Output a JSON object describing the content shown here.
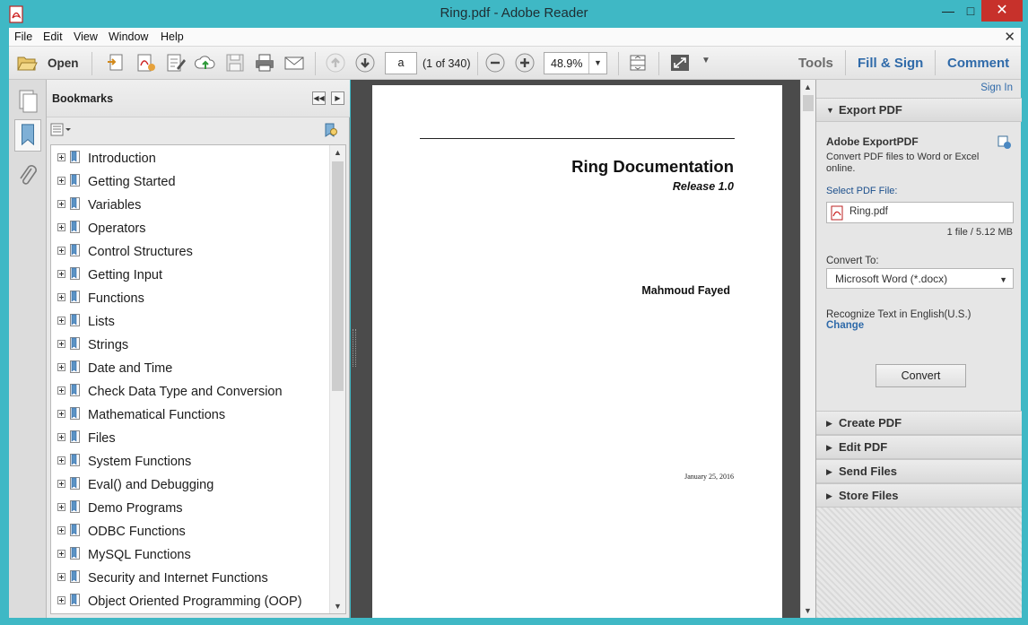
{
  "window": {
    "title": "Ring.pdf - Adobe Reader",
    "minimize": "—",
    "maximize": "□",
    "close": "✕"
  },
  "menu": {
    "items": [
      "File",
      "Edit",
      "View",
      "Window",
      "Help"
    ],
    "close_glyph": "✕"
  },
  "toolbar": {
    "open_label": "Open",
    "page_value": "a",
    "page_count": "(1 of 340)",
    "zoom": "48.9%",
    "tools": "Tools",
    "fill_sign": "Fill & Sign",
    "comment": "Comment"
  },
  "bookmarks": {
    "title": "Bookmarks",
    "items": [
      "Introduction",
      "Getting Started",
      "Variables",
      "Operators",
      "Control Structures",
      "Getting Input",
      "Functions",
      "Lists",
      "Strings",
      "Date and Time",
      "Check Data Type and Conversion",
      "Mathematical Functions",
      "Files",
      "System Functions",
      "Eval() and Debugging",
      "Demo Programs",
      "ODBC Functions",
      "MySQL Functions",
      "Security and Internet Functions",
      "Object Oriented Programming (OOP)"
    ]
  },
  "document": {
    "title": "Ring Documentation",
    "release": "Release 1.0",
    "author": "Mahmoud Fayed",
    "date": "January 25, 2016"
  },
  "right_pane": {
    "sign_in": "Sign In",
    "export_pdf": "Export PDF",
    "export_title": "Adobe ExportPDF",
    "export_desc": "Convert PDF files to Word or Excel online.",
    "select_label": "Select PDF File:",
    "file_name": "Ring.pdf",
    "file_size": "1 file / 5.12 MB",
    "convert_to_label": "Convert To:",
    "convert_to_value": "Microsoft Word (*.docx)",
    "recognize": "Recognize Text in English(U.S.)",
    "change": "Change",
    "convert_button": "Convert",
    "sections": [
      "Create PDF",
      "Edit PDF",
      "Send Files",
      "Store Files"
    ]
  },
  "colors": {
    "window_frame": "#3fb8c5",
    "close_button": "#c7312b",
    "link_blue": "#2f6aa9",
    "doc_background": "#4b4b4b"
  }
}
